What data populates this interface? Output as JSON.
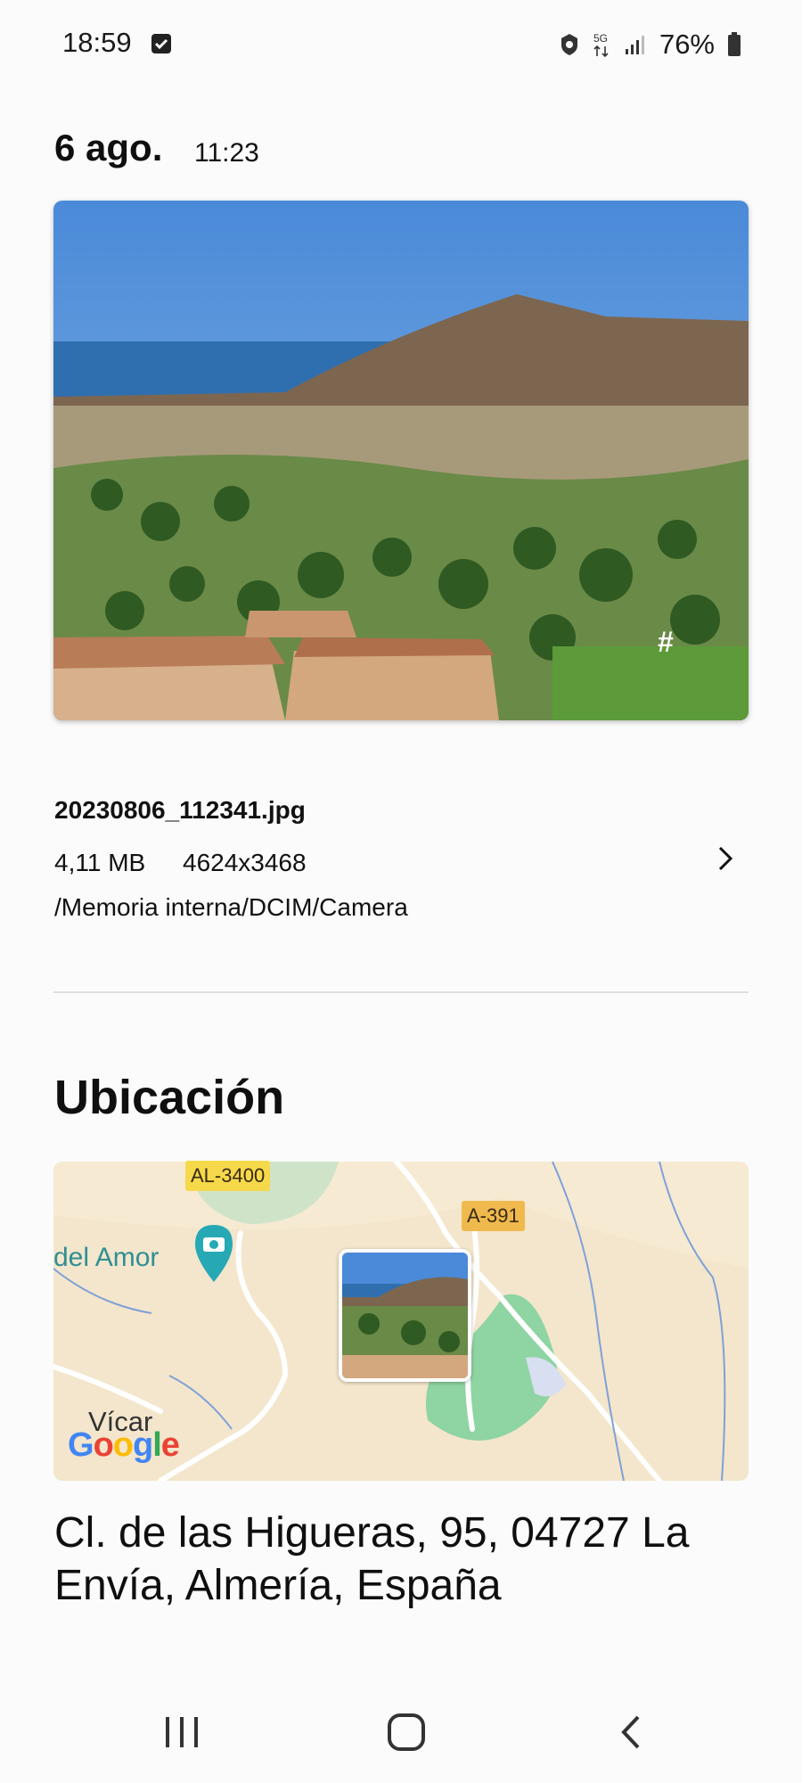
{
  "status_bar": {
    "time": "18:59",
    "network": "5G",
    "battery": "76%"
  },
  "header": {
    "date": "6 ago.",
    "time": "11:23"
  },
  "photo": {
    "overlay_icon": "#"
  },
  "file": {
    "name": "20230806_112341.jpg",
    "size": "4,11 MB",
    "resolution": "4624x3468",
    "path": "/Memoria interna/DCIM/Camera"
  },
  "location": {
    "title": "Ubicación",
    "map": {
      "road_1": "AL-3400",
      "road_2": "A-391",
      "poi": "del Amor",
      "town": "Vícar",
      "attribution": "Google"
    },
    "address": "Cl. de las Higueras, 95, 04727 La Envía, Almería, España"
  },
  "nav": {
    "recents_icon": "recents-icon",
    "home_icon": "home-icon",
    "back_icon": "back-icon"
  }
}
